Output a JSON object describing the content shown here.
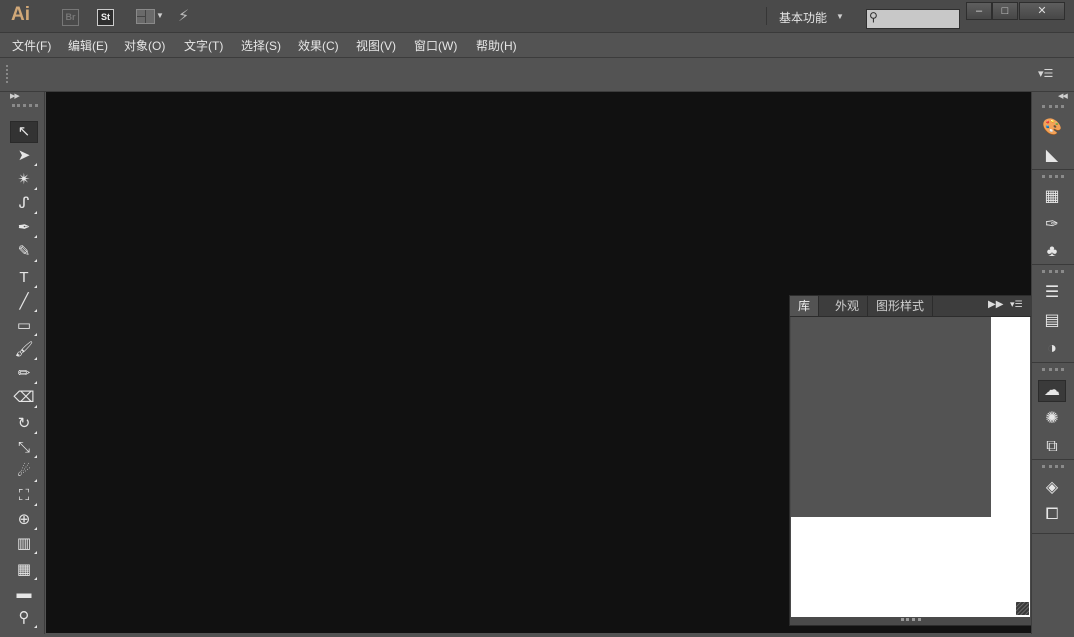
{
  "app": {
    "logo": "Ai",
    "bridge_label": "Br",
    "stock_label": "St",
    "workspace": "基本功能",
    "search_placeholder": ""
  },
  "window_controls": {
    "minimize": "‒",
    "maximize": "□",
    "close": "✕"
  },
  "menu": [
    "文件(F)",
    "编辑(E)",
    "对象(O)",
    "文字(T)",
    "选择(S)",
    "效果(C)",
    "视图(V)",
    "窗口(W)",
    "帮助(H)"
  ],
  "tools": [
    {
      "icon": "selection-tool-icon",
      "glyph": "↖",
      "selected": true
    },
    {
      "icon": "direct-selection-tool-icon",
      "glyph": "➤"
    },
    {
      "icon": "magic-wand-tool-icon",
      "glyph": "✴"
    },
    {
      "icon": "lasso-tool-icon",
      "glyph": "ᔑ"
    },
    {
      "icon": "pen-tool-icon",
      "glyph": "✒"
    },
    {
      "icon": "curvature-tool-icon",
      "glyph": "✎"
    },
    {
      "icon": "type-tool-icon",
      "glyph": "T"
    },
    {
      "icon": "line-tool-icon",
      "glyph": "╱"
    },
    {
      "icon": "rectangle-tool-icon",
      "glyph": "▭"
    },
    {
      "icon": "paintbrush-tool-icon",
      "glyph": "🖌"
    },
    {
      "icon": "pencil-tool-icon",
      "glyph": "✏"
    },
    {
      "icon": "eraser-tool-icon",
      "glyph": "⌫"
    },
    {
      "icon": "rotate-tool-icon",
      "glyph": "↻"
    },
    {
      "icon": "scale-tool-icon",
      "glyph": "⤡"
    },
    {
      "icon": "warp-tool-icon",
      "glyph": "☄"
    },
    {
      "icon": "free-transform-tool-icon",
      "glyph": "⛶"
    },
    {
      "icon": "shape-builder-tool-icon",
      "glyph": "⊕"
    },
    {
      "icon": "graph-tool-icon",
      "glyph": "▥"
    },
    {
      "icon": "mesh-tool-icon",
      "glyph": "▦"
    },
    {
      "icon": "gradient-tool-icon",
      "glyph": "▬"
    },
    {
      "icon": "eyedropper-tool-icon",
      "glyph": "⚲"
    }
  ],
  "panel": {
    "tabs": [
      "库",
      "外观",
      "图形样式"
    ],
    "active_tab": 0
  },
  "dock_buttons": [
    {
      "icon": "color-palette-icon",
      "glyph": "🎨"
    },
    {
      "icon": "color-guide-icon",
      "glyph": "◣"
    },
    {
      "icon": "swatches-icon",
      "glyph": "▦"
    },
    {
      "icon": "brushes-icon",
      "glyph": "✑"
    },
    {
      "icon": "symbols-icon",
      "glyph": "♣"
    },
    {
      "icon": "stroke-icon",
      "glyph": "☰"
    },
    {
      "icon": "gradient-icon",
      "glyph": "▤"
    },
    {
      "icon": "transparency-icon",
      "glyph": "◑"
    },
    {
      "icon": "creative-cloud-libraries-icon",
      "glyph": "☁"
    },
    {
      "icon": "appearance-icon",
      "glyph": "✺"
    },
    {
      "icon": "graphic-styles-icon",
      "glyph": "⧉"
    },
    {
      "icon": "layers-icon",
      "glyph": "◈"
    },
    {
      "icon": "artboards-icon",
      "glyph": "⧠"
    }
  ]
}
